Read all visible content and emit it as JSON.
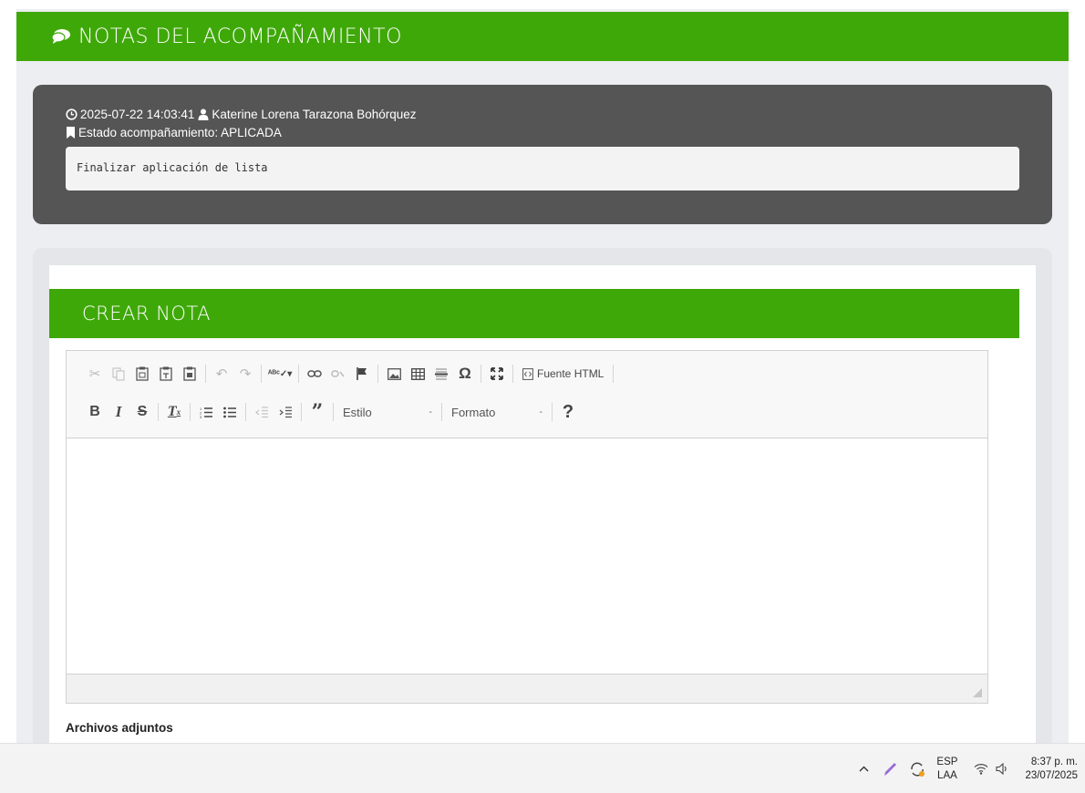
{
  "header": {
    "title": "NOTAS DEL ACOMPAÑAMIENTO",
    "icon": "comments-icon"
  },
  "note": {
    "timestamp": "2025-07-22 14:03:41",
    "author": "Katerine Lorena Tarazona Bohórquez",
    "status_line": "Estado acompañamiento: APLICADA",
    "text": "Finalizar aplicación de lista"
  },
  "create": {
    "title": "CREAR NOTA",
    "toolbar": {
      "source_label": "Fuente HTML",
      "style_label": "Estilo",
      "format_label": "Formato",
      "help_label": "?"
    },
    "attachments_label": "Archivos adjuntos"
  },
  "taskbar": {
    "lang_top": "ESP",
    "lang_bottom": "LAA",
    "time": "8:37 p. m.",
    "date": "23/07/2025"
  },
  "colors": {
    "accent_green": "#3fa809",
    "note_card": "#555555",
    "panel_bg": "#eceef1"
  }
}
